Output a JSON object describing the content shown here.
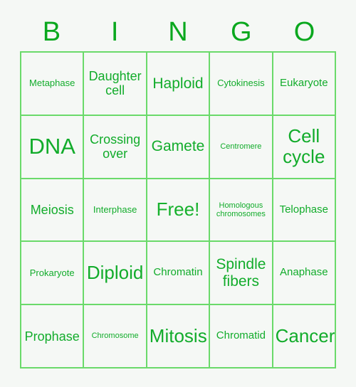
{
  "card": {
    "title_letters": [
      "B",
      "I",
      "N",
      "G",
      "O"
    ],
    "colors": {
      "background": "#f5f8f5",
      "grid_line": "#6ada6a",
      "text": "#12ac2b",
      "header_text": "#0aa81e"
    },
    "rows": [
      [
        {
          "label": "Metaphase",
          "size": "fs-s"
        },
        {
          "label": "Daughter cell",
          "size": "fs-l"
        },
        {
          "label": "Haploid",
          "size": "fs-xl"
        },
        {
          "label": "Cytokinesis",
          "size": "fs-s"
        },
        {
          "label": "Eukaryote",
          "size": "fs-m"
        }
      ],
      [
        {
          "label": "DNA",
          "size": "fs-huge"
        },
        {
          "label": "Crossing over",
          "size": "fs-l"
        },
        {
          "label": "Gamete",
          "size": "fs-xl"
        },
        {
          "label": "Centromere",
          "size": "fs-xs"
        },
        {
          "label": "Cell cycle",
          "size": "fs-xxl"
        }
      ],
      [
        {
          "label": "Meiosis",
          "size": "fs-l"
        },
        {
          "label": "Interphase",
          "size": "fs-s"
        },
        {
          "label": "Free!",
          "size": "fs-xxl",
          "free": true
        },
        {
          "label": "Homologous chromosomes",
          "size": "fs-xs"
        },
        {
          "label": "Telophase",
          "size": "fs-m"
        }
      ],
      [
        {
          "label": "Prokaryote",
          "size": "fs-s"
        },
        {
          "label": "Diploid",
          "size": "fs-xxl"
        },
        {
          "label": "Chromatin",
          "size": "fs-m"
        },
        {
          "label": "Spindle fibers",
          "size": "fs-xl"
        },
        {
          "label": "Anaphase",
          "size": "fs-m"
        }
      ],
      [
        {
          "label": "Prophase",
          "size": "fs-l"
        },
        {
          "label": "Chromosome",
          "size": "fs-xs"
        },
        {
          "label": "Mitosis",
          "size": "fs-xxl"
        },
        {
          "label": "Chromatid",
          "size": "fs-m"
        },
        {
          "label": "Cancer",
          "size": "fs-xxl"
        }
      ]
    ]
  }
}
